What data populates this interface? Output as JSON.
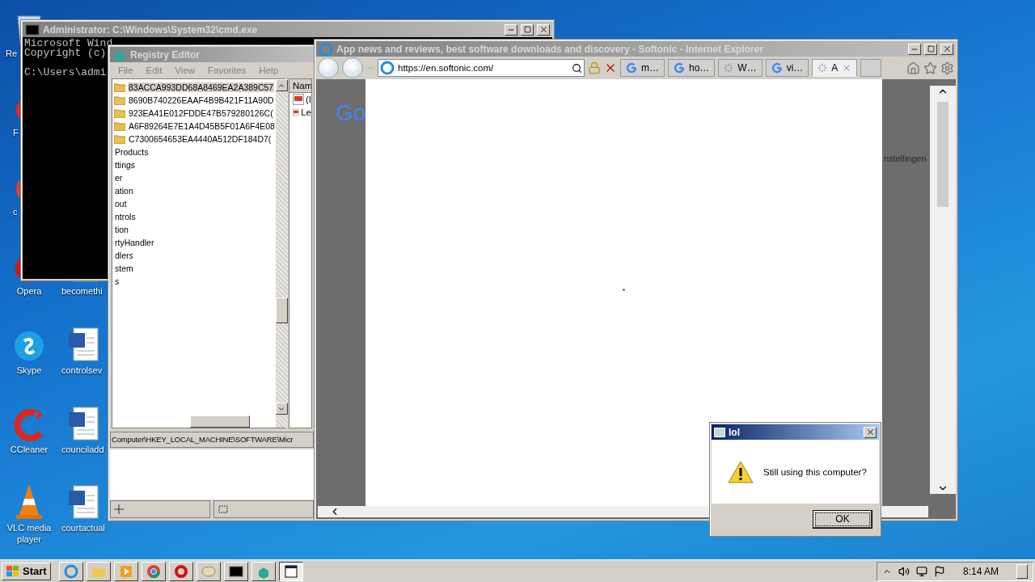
{
  "desktop": {
    "column_1": [
      {
        "label": "Re"
      },
      {
        "label": "F"
      },
      {
        "label": "c"
      },
      {
        "label": "Opera"
      },
      {
        "label": "Skype"
      },
      {
        "label": "CCleaner"
      },
      {
        "label": "VLC media player"
      }
    ],
    "column_2": [
      {
        "label": "becomethi"
      },
      {
        "label": "controlsev"
      },
      {
        "label": "counciladd"
      },
      {
        "label": "courtactual"
      }
    ]
  },
  "cmd": {
    "title": "Administrator: C:\\Windows\\System32\\cmd.exe",
    "lines": [
      "Microsoft Wind",
      "Copyright (c)",
      "C:\\Users\\admi"
    ]
  },
  "regedit": {
    "title": "Registry Editor",
    "menu": [
      "File",
      "Edit",
      "View",
      "Favorites",
      "Help"
    ],
    "tree": [
      {
        "label": "83ACCA993DD68A8469EA2A389C57",
        "folder": true,
        "selected": true
      },
      {
        "label": "8690B740226EAAF4B9B421F11A90D",
        "folder": true,
        "selected": false
      },
      {
        "label": "923EA41E012FDDE47B579280126C(",
        "folder": true,
        "selected": false
      },
      {
        "label": "A6F89264E7E1A4D45B5F01A6F4E08",
        "folder": true,
        "selected": false
      },
      {
        "label": "C7300654653EA4440A512DF184D7(",
        "folder": true,
        "selected": false
      },
      {
        "label": "Products",
        "folder": false,
        "selected": false
      },
      {
        "label": "ttings",
        "folder": false,
        "selected": false
      },
      {
        "label": "er",
        "folder": false,
        "selected": false
      },
      {
        "label": "ation",
        "folder": false,
        "selected": false
      },
      {
        "label": "out",
        "folder": false,
        "selected": false
      },
      {
        "label": "ntrols",
        "folder": false,
        "selected": false
      },
      {
        "label": "tion",
        "folder": false,
        "selected": false
      },
      {
        "label": "rtyHandler",
        "folder": false,
        "selected": false
      },
      {
        "label": "dlers",
        "folder": false,
        "selected": false
      },
      {
        "label": "stem",
        "folder": false,
        "selected": false
      },
      {
        "label": "s",
        "folder": false,
        "selected": false
      }
    ],
    "values_header": "Nam",
    "values": [
      "(I",
      "Le"
    ],
    "status_path": "Computer\\HKEY_LOCAL_MACHINE\\SOFTWARE\\Micr"
  },
  "browser": {
    "title": "App news and reviews, best software downloads and discovery - Softonic - Internet Explorer",
    "address": "https://en.softonic.com/",
    "tabs": [
      {
        "label": "m…",
        "selected": false,
        "loading": false
      },
      {
        "label": "ho…",
        "selected": false,
        "loading": false
      },
      {
        "label": "W…",
        "selected": false,
        "loading": true
      },
      {
        "label": "vi…",
        "selected": false,
        "loading": false
      },
      {
        "label": "A",
        "selected": true,
        "loading": true
      }
    ],
    "page_logo": "Go",
    "page_link": "nstellingen"
  },
  "dialog": {
    "title": "lol",
    "message": "Still using this computer?",
    "button": "OK"
  },
  "taskbar": {
    "start": "Start",
    "items": [
      {
        "selected": false
      },
      {
        "selected": false
      },
      {
        "selected": false
      },
      {
        "selected": false
      },
      {
        "selected": false
      },
      {
        "selected": false
      },
      {
        "selected": false
      },
      {
        "selected": false
      },
      {
        "selected": true
      }
    ],
    "time": "8:14 AM"
  }
}
